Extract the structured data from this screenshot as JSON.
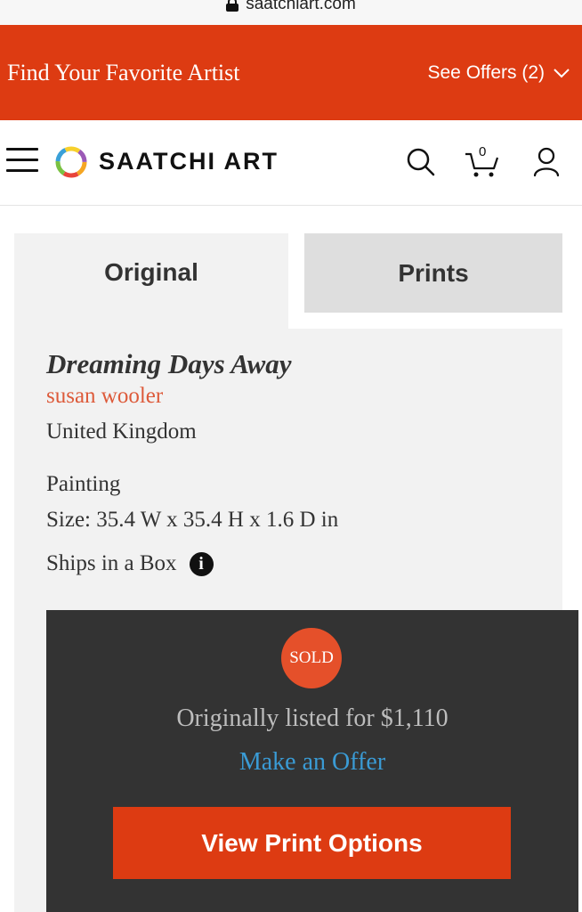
{
  "browser": {
    "url": "saatchiart.com"
  },
  "promo": {
    "title": "Find Your Favorite Artist",
    "offers_label": "See Offers (2)"
  },
  "header": {
    "logo_text": "SAATCHI ART",
    "cart_count": "0"
  },
  "tabs": [
    {
      "label": "Original",
      "active": true
    },
    {
      "label": "Prints",
      "active": false
    }
  ],
  "artwork": {
    "title": "Dreaming Days Away",
    "artist": "susan wooler",
    "country": "United Kingdom",
    "medium": "Painting",
    "size": "Size: 35.4 W x 35.4 H x 1.6 D in",
    "shipping": "Ships in a Box"
  },
  "purchase": {
    "status_badge": "SOLD",
    "original_price_text": "Originally listed for $1,110",
    "offer_link": "Make an Offer",
    "cta": "View Print Options"
  },
  "colors": {
    "brand": "#dd3b12",
    "link": "#3a9bd5",
    "artist": "#dd5a3a",
    "panel": "#333333"
  }
}
